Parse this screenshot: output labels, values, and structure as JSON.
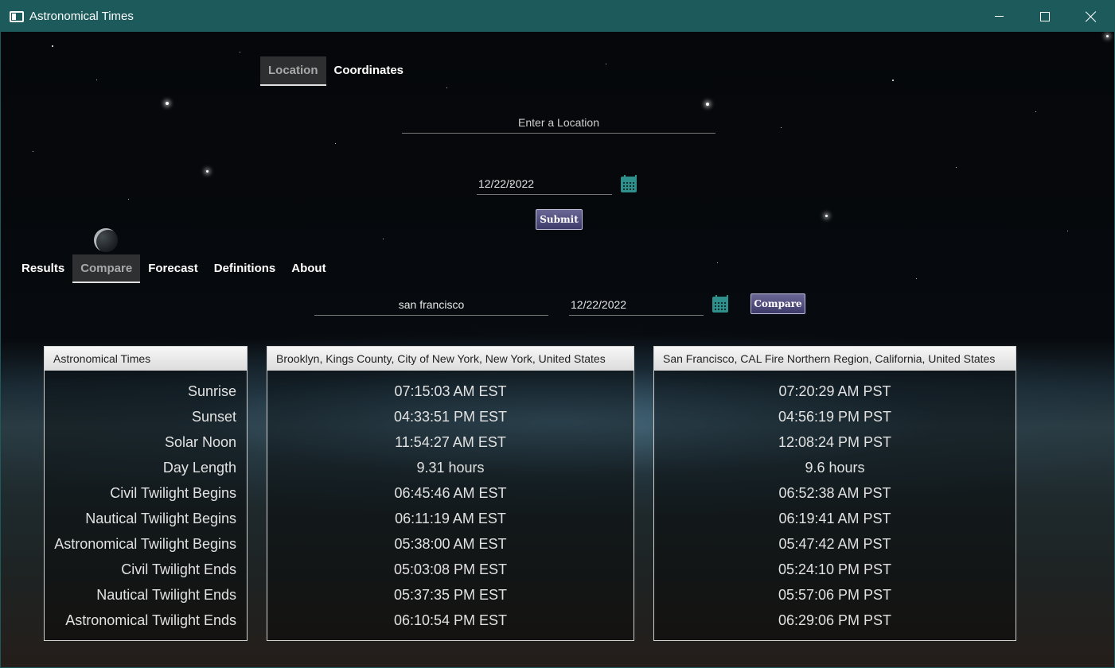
{
  "window": {
    "title": "Astronomical Times"
  },
  "top_tabs": [
    {
      "label": "Location",
      "active": true
    },
    {
      "label": "Coordinates",
      "active": false
    }
  ],
  "location_input": {
    "placeholder": "Enter a Location",
    "value": ""
  },
  "date": {
    "value": "12/22/2022"
  },
  "submit_label": "Submit",
  "bottom_tabs": [
    {
      "label": "Results",
      "active": false
    },
    {
      "label": "Compare",
      "active": true
    },
    {
      "label": "Forecast",
      "active": false
    },
    {
      "label": "Definitions",
      "active": false
    },
    {
      "label": "About",
      "active": false
    }
  ],
  "compare": {
    "location_value": "san francisco",
    "date_value": "12/22/2022",
    "button_label": "Compare"
  },
  "table": {
    "label_header": "Astronomical Times",
    "labels": [
      "Sunrise",
      "Sunset",
      "Solar Noon",
      "Day Length",
      "Civil Twilight Begins",
      "Nautical Twilight Begins",
      "Astronomical Twilight Begins",
      "Civil Twilight Ends",
      "Nautical Twilight Ends",
      "Astronomical Twilight Ends"
    ],
    "location1": {
      "header": "Brooklyn, Kings County, City of New York, New York, United States",
      "values": [
        "07:15:03 AM EST",
        "04:33:51 PM EST",
        "11:54:27 AM EST",
        "9.31 hours",
        "06:45:46 AM EST",
        "06:11:19 AM EST",
        "05:38:00 AM EST",
        "05:03:08 PM EST",
        "05:37:35 PM EST",
        "06:10:54 PM EST"
      ]
    },
    "location2": {
      "header": "San Francisco, CAL Fire Northern Region, California, United States",
      "values": [
        "07:20:29 AM PST",
        "04:56:19 PM PST",
        "12:08:24 PM PST",
        "9.6 hours",
        "06:52:38 AM PST",
        "06:19:41 AM PST",
        "05:47:42 AM PST",
        "05:24:10 PM PST",
        "05:57:06 PM PST",
        "06:29:06 PM PST"
      ]
    }
  }
}
